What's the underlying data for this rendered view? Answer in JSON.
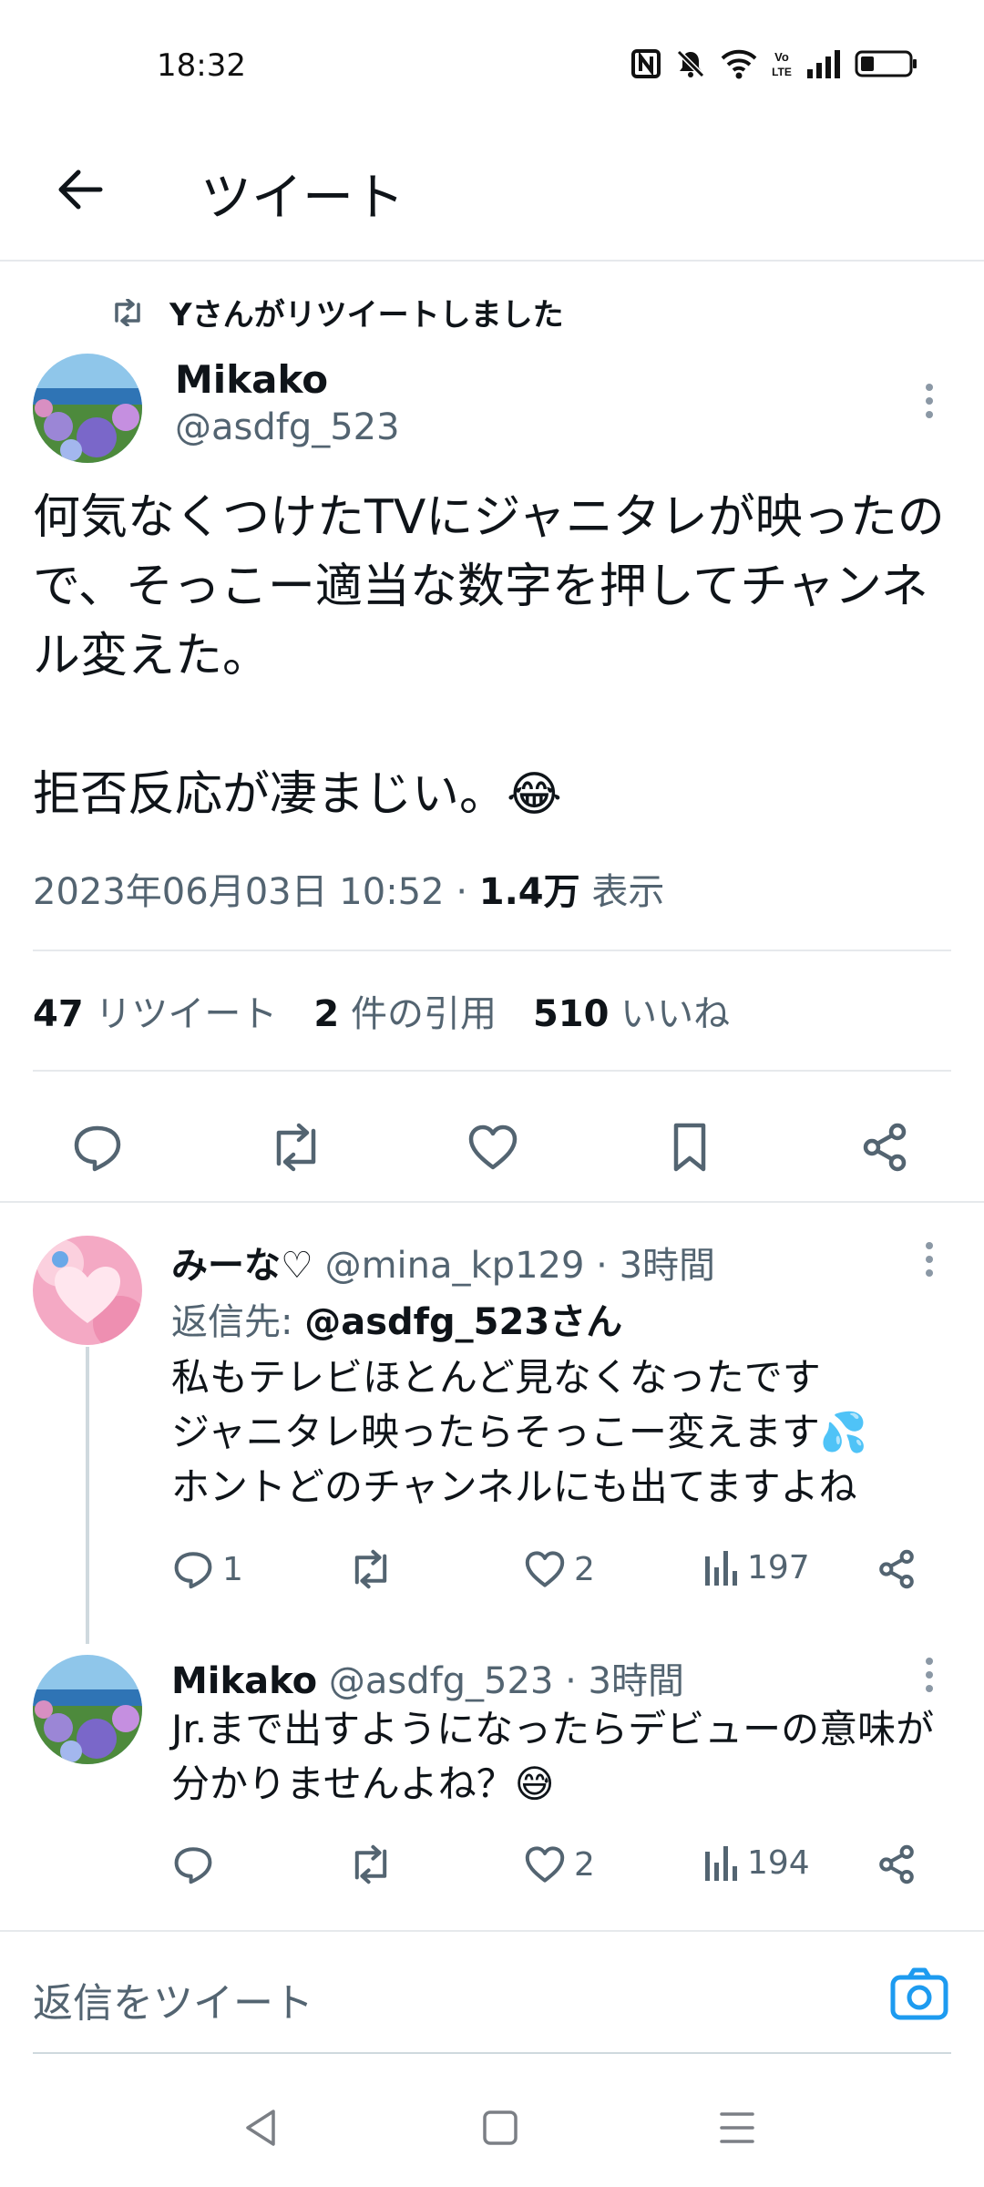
{
  "status_bar": {
    "time": "18:32",
    "icons": [
      "nfc-icon",
      "mute-icon",
      "wifi-icon",
      "volte-icon",
      "signal-icon",
      "battery-icon"
    ]
  },
  "header": {
    "title": "ツイート"
  },
  "tweet": {
    "retweet_label": "Yさんがリツイートしました",
    "author_name": "Mikako",
    "author_handle": "@asdfg_523",
    "text": "何気なくつけたTVにジャニタレが映ったので、そっこー適当な数字を押してチャンネル変えた。\n\n拒否反応が凄まじい。😂",
    "timestamp": "2023年06月03日 10:52",
    "separator": "·",
    "views_count": "1.4万",
    "views_label": "表示",
    "stats": {
      "retweets_count": "47",
      "retweets_label": "リツイート",
      "quotes_count": "2",
      "quotes_label": "件の引用",
      "likes_count": "510",
      "likes_label": "いいね"
    }
  },
  "replies": [
    {
      "name": "みーな♡",
      "handle": "@mina_kp129",
      "time": "· 3時間",
      "reply_to_label": "返信先:",
      "reply_to_handle": "@asdfg_523さん",
      "text": "私もテレビほとんど見なくなったです\nジャニタレ映ったらそっこー変えます💦\nホントどのチャンネルにも出てますよね",
      "reply_count": "1",
      "like_count": "2",
      "view_count": "197"
    },
    {
      "name": "Mikako",
      "handle": "@asdfg_523",
      "time": "· 3時間",
      "text": "Jr.まで出すようになったらデビューの意味が分かりませんよね？😅",
      "like_count": "2",
      "view_count": "194"
    }
  ],
  "composer": {
    "placeholder": "返信をツイート"
  },
  "colors": {
    "text_primary": "#0f1419",
    "text_secondary": "#536471",
    "accent": "#1d9bf0",
    "divider": "#e6e9ec"
  }
}
